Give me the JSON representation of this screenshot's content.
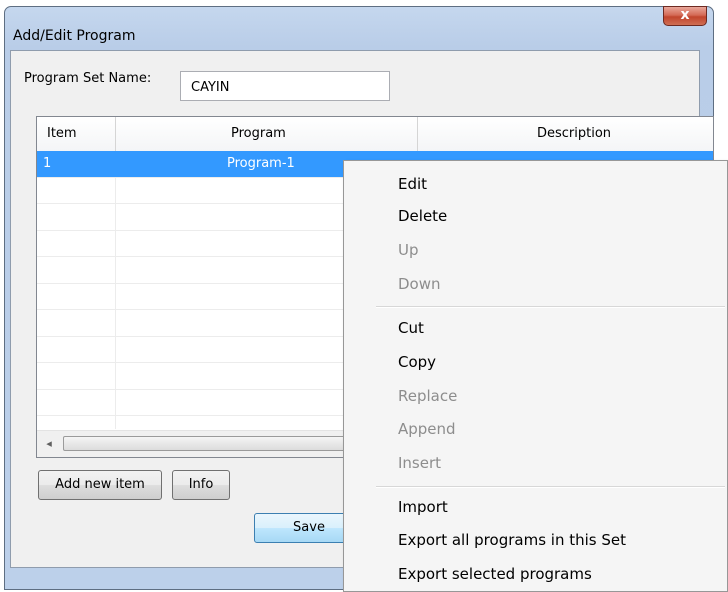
{
  "window": {
    "title": "Add/Edit Program",
    "close_glyph": "x"
  },
  "form": {
    "program_set_name_label": "Program Set Name:",
    "program_set_name_value": "CAYIN"
  },
  "table": {
    "columns": [
      "Item",
      "Program",
      "Description"
    ],
    "rows": [
      {
        "item": "1",
        "program": "Program-1",
        "description": ""
      }
    ],
    "selected_row_color": "#3399ff",
    "scroll_left_glyph": "◂"
  },
  "buttons": {
    "add_new_item": "Add new item",
    "info": "Info",
    "save": "Save"
  },
  "context_menu": {
    "items": [
      {
        "label": "Edit",
        "enabled": true
      },
      {
        "label": "Delete",
        "enabled": true
      },
      {
        "label": "Up",
        "enabled": false
      },
      {
        "label": "Down",
        "enabled": false
      },
      {
        "label": "Cut",
        "enabled": true
      },
      {
        "label": "Copy",
        "enabled": true
      },
      {
        "label": "Replace",
        "enabled": false
      },
      {
        "label": "Append",
        "enabled": false
      },
      {
        "label": "Insert",
        "enabled": false
      },
      {
        "label": "Import",
        "enabled": true
      },
      {
        "label": "Export all programs in this Set",
        "enabled": true
      },
      {
        "label": "Export selected programs",
        "enabled": true
      }
    ]
  },
  "colors": {
    "frame_accent": "#bcd0ea",
    "close_button": "#c1452d",
    "disabled_text": "#8d8d8d"
  }
}
